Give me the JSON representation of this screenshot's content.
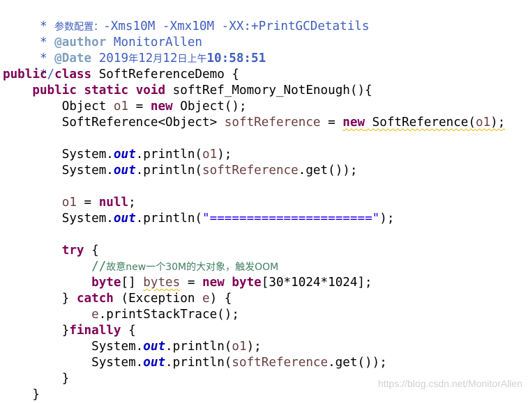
{
  "colors": {
    "keyword": "#7f0055",
    "javadoc": "#3f5fbf",
    "javadoc_tag": "#7f9fbf",
    "line_comment": "#3f7f5f",
    "static_field": "#0000c0",
    "local_variable": "#6a3e3e",
    "string": "#2a00ff",
    "background": "#ffffff"
  },
  "code": {
    "l1": [
      "*",
      "参数配置：",
      "-Xms10M -Xmx10M -XX:+PrintGCDetatils"
    ],
    "l2": [
      "*",
      "@author",
      "MonitorAllen"
    ],
    "l3": [
      "*",
      "@Date",
      "2019",
      "年",
      "12",
      "月",
      "12",
      "日上午",
      "10:58:51"
    ],
    "l4": [
      "*/"
    ],
    "l5": [
      "public",
      "class",
      "SoftReferenceDemo {"
    ],
    "l6": [
      "public",
      "static",
      "void",
      "softRef_Momory_NotEnough(){"
    ],
    "l7": [
      "Object",
      "o1",
      " = ",
      "new",
      " Object();"
    ],
    "l8": [
      "SoftReference<Object>",
      "softReference",
      " = ",
      "new",
      " SoftReference(",
      "o1",
      ");"
    ],
    "l10": [
      "System.",
      "out",
      ".println(",
      "o1",
      ");"
    ],
    "l11": [
      "System.",
      "out",
      ".println(",
      "softReference",
      ".get());"
    ],
    "l13": [
      "o1",
      " = ",
      "null",
      ";"
    ],
    "l14": [
      "System.",
      "out",
      ".println(",
      "\"======================\"",
      ");"
    ],
    "l16": [
      "try",
      " {"
    ],
    "l17": [
      "//",
      "故意",
      "new",
      "一个",
      "30M",
      "的大对象，触发",
      "OOM"
    ],
    "l18": [
      "byte",
      "[] ",
      "bytes",
      " = ",
      "new",
      "byte",
      "[30*1024*1024];"
    ],
    "l19": [
      "} ",
      "catch",
      " (Exception ",
      "e",
      ") {"
    ],
    "l20": [
      "e",
      ".printStackTrace();"
    ],
    "l21": [
      "}",
      "finally",
      " {"
    ],
    "l22": [
      "System.",
      "out",
      ".println(",
      "o1",
      ");"
    ],
    "l23": [
      "System.",
      "out",
      ".println(",
      "softReference",
      ".get());"
    ],
    "l24": [
      "}"
    ],
    "l25": [
      "}"
    ]
  },
  "watermark": "https://blog.csdn.net/MonitorAllen"
}
